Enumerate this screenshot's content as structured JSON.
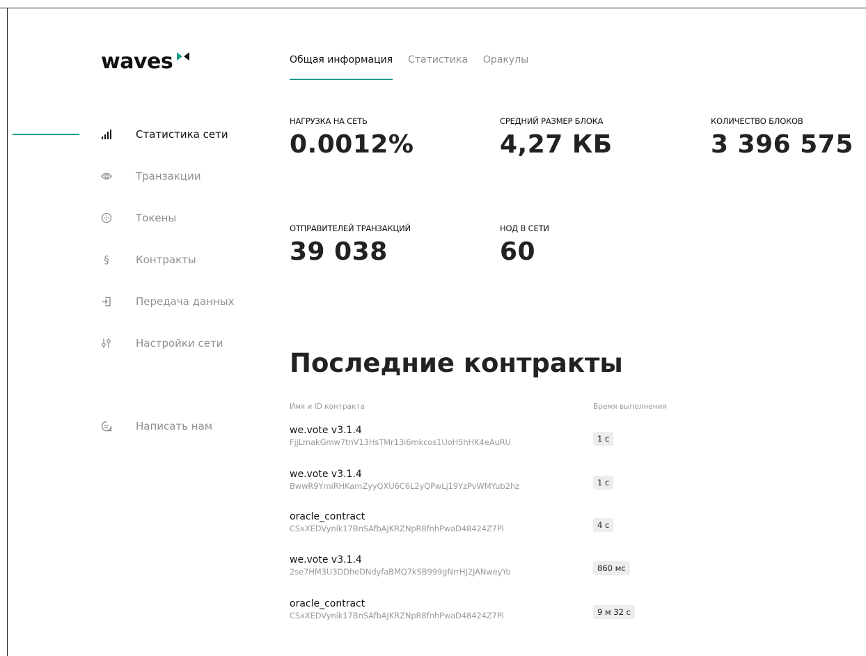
{
  "logo": {
    "text": "waves"
  },
  "tabs": [
    {
      "label": "Общая информация",
      "active": true
    },
    {
      "label": "Статистика",
      "active": false
    },
    {
      "label": "Оракулы",
      "active": false
    }
  ],
  "sidebar": {
    "items": [
      {
        "label": "Статистика сети",
        "icon": "bar-chart-icon",
        "active": true
      },
      {
        "label": "Транзакции",
        "icon": "eye-icon",
        "active": false
      },
      {
        "label": "Токены",
        "icon": "token-icon",
        "active": false
      },
      {
        "label": "Контракты",
        "icon": "section-icon",
        "active": false
      },
      {
        "label": "Передача данных",
        "icon": "data-transfer-icon",
        "active": false
      },
      {
        "label": "Настройки сети",
        "icon": "sliders-icon",
        "active": false
      },
      {
        "label": "Написать нам",
        "icon": "chat-icon",
        "active": false
      }
    ]
  },
  "stats": [
    {
      "label": "НАГРУЗКА НА СЕТЬ",
      "value": "0.0012%"
    },
    {
      "label": "СРЕДНИЙ РАЗМЕР БЛОКА",
      "value": "4,27 КБ"
    },
    {
      "label": "КОЛИЧЕСТВО БЛОКОВ",
      "value": "3 396 575"
    },
    {
      "label": "ОТПРАВИТЕЛЕЙ ТРАНЗАКЦИЙ",
      "value": "39 038"
    },
    {
      "label": "НОД В СЕТИ",
      "value": "60"
    }
  ],
  "contracts": {
    "title": "Последние контракты",
    "col_name": "Имя и ID контракта",
    "col_time": "Время выполнения",
    "rows": [
      {
        "name": "we.vote v3.1.4",
        "id": "FjjLmakGmw7tnV13HsTMr13i6mkcos1UoH5hHK4eAuRU",
        "time": "1 с"
      },
      {
        "name": "we.vote v3.1.4",
        "id": "BwwR9YmiRHKamZyyQXU6C6L2yQPwLj19YzPvWMYub2hz",
        "time": "1 с"
      },
      {
        "name": "oracle_contract",
        "id": "CSxXEDVynik17BnSAfbAJKRZNpR8fnhPwaD48424Z7Pi",
        "time": "4 с"
      },
      {
        "name": "we.vote v3.1.4",
        "id": "2se7HM3U3DDheDNdyfaBMQ7kSB999gNrrHJ2JANweyYo",
        "time": "860 мс"
      },
      {
        "name": "oracle_contract",
        "id": "CSxXEDVynik17BnSAfbAJKRZNpR8fnhPwaD48424Z7Pi",
        "time": "9 м 32 с"
      }
    ]
  },
  "colors": {
    "accent": "#1e9b8e",
    "text": "#111111",
    "muted": "#8f8f8f"
  }
}
